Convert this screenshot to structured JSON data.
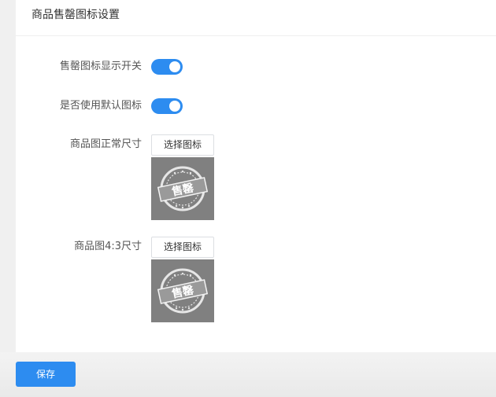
{
  "panel": {
    "title": "商品售罄图标设置"
  },
  "settings": {
    "show_switch": {
      "label": "售罄图标显示开关",
      "enabled": true
    },
    "use_default": {
      "label": "是否使用默认图标",
      "enabled": true
    },
    "normal_size": {
      "label": "商品图正常尺寸",
      "button": "选择图标"
    },
    "ratio_size": {
      "label": "商品图4:3尺寸",
      "button": "选择图标"
    }
  },
  "stamp": {
    "text": "售罄"
  },
  "footer": {
    "save_label": "保存"
  },
  "colors": {
    "accent": "#2d8cf0",
    "thumb_bg": "#808080"
  }
}
